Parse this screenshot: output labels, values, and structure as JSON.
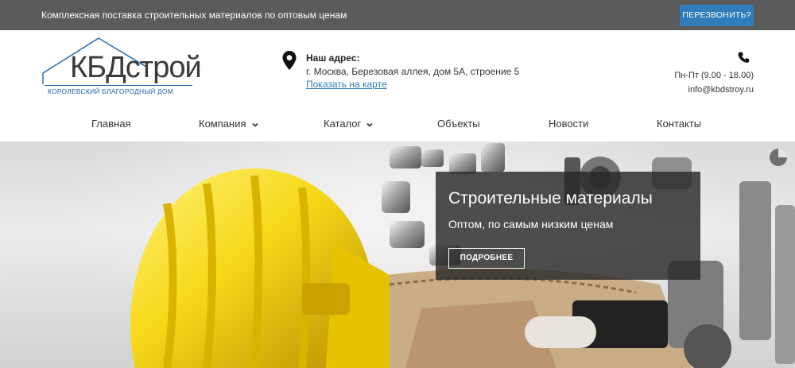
{
  "topbar": {
    "tagline": "Комплексная поставка строительных материалов по оптовым ценам",
    "callback_label": "ПЕРЕЗВОНИТЬ?"
  },
  "logo": {
    "text": "КБДстрой",
    "subtitle": "КОРОЛЕВСКИЙ БЛАГОРОДНЫЙ ДОМ"
  },
  "address": {
    "icon": "map-pin-icon",
    "label": "Наш адрес:",
    "value": "г. Москва, Березовая аллея, дом 5А, строение 5",
    "map_link": "Показать на карте"
  },
  "contact": {
    "icon": "phone-icon",
    "hours": "Пн-Пт (9.00 - 18.00)",
    "email": "info@kbdstroy.ru"
  },
  "nav": {
    "items": [
      {
        "label": "Главная"
      },
      {
        "label": "Компания"
      },
      {
        "label": "Каталог"
      },
      {
        "label": "Объекты"
      },
      {
        "label": "Новости"
      },
      {
        "label": "Контакты"
      }
    ]
  },
  "slide": {
    "title": "Строительные материалы",
    "subtitle": "Оптом, по самым низким ценам",
    "button_label": "ПОДРОБНЕЕ"
  },
  "colors": {
    "topbar_bg": "#5b5b5b",
    "accent": "#2f7dba",
    "overlay": "#282828"
  }
}
